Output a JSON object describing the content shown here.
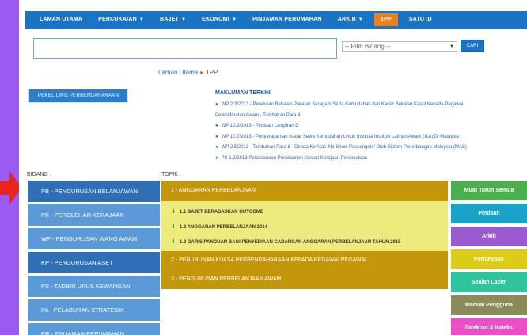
{
  "nav": {
    "items": [
      {
        "label": "LAMAN UTAMA",
        "caret": false
      },
      {
        "label": "PERCUKAIAN",
        "caret": true
      },
      {
        "label": "BAJET",
        "caret": true
      },
      {
        "label": "EKONOMI",
        "caret": true
      },
      {
        "label": "PINJAMAN PERUMAHAN",
        "caret": false
      },
      {
        "label": "ARKIB",
        "caret": true
      },
      {
        "label": "1PP",
        "caret": false
      },
      {
        "label": "SATU ID",
        "caret": false
      }
    ],
    "caret_glyph": "▼"
  },
  "search": {
    "value": "",
    "select_value": "-- Pilih Bidang --",
    "button_label": "CARI"
  },
  "breadcrumb": {
    "home": "Laman Utama",
    "separator": "▸",
    "current": "1PP"
  },
  "pekeliling_button": "PEKELILING PERBENDAHARAAN",
  "makluman": {
    "title": "MAKLUMAN TERKINI",
    "items": [
      "WP 2.3/2013 - Peraturan Bekalan Pakaian Seragam Serta Kemudahan dan Kadar Bekalan Kasut Kepada Pegawai",
      "Perkhidmatan Awam - Tambahan Para 4",
      "WP 10.2/2013 - Pindaan Lampiran D",
      "WP 10.7/2013 - Penyeragaman Kadar Sewa Kemudahan Untuk Institusi Institusi Latihan Awam (ILA) Di Malaysia",
      "WP 2.5/2013 - Tambahan Para 8 - Denda Ke Atas 'No Show Passengers' Oleh Sistem Penerbangan Malaysia (MAS)",
      "PS 1.2/2013 Pelaksanaan Perakaunan Akruan Kerajaan Persekutuan"
    ],
    "bullet": "●"
  },
  "bidang": {
    "label": "BIDANG :",
    "items": [
      "PB - PENGURUSAN BELANJAWAN",
      "PK - PEROLEHAN KERAJAAN",
      "WP - PENGURUSAN WANG AWAM",
      "KP - PENGURUSAN ASET",
      "PS - TADBIR URUS KEWANGAN",
      "PA - PELABURAN STRATEGIK",
      "PR - PINJAMAN PERUMAHAN"
    ]
  },
  "topik": {
    "label": "TOPIK :",
    "head1": "1 - ANGGARAN PERBELANJAAN",
    "subitems": [
      "1.1 BAJET BERASASKAN OUTCOME",
      "1.2 ANGGARAN PERBELANJAAN 2014",
      "1.3 GARIS PANDUAN BAGI PENYEDIAAN CADANGAN ANGGARAN PERBELANJAAN TAHUN 2015"
    ],
    "down_glyph": "⬇",
    "head2": "2 - PENURUNAN KUASA PERBENDAHARAAN KEPADA PEGAWAI PEGAWAL",
    "head3": "3 - PENGURUSAN PERBELANJAAN AWAM"
  },
  "side_buttons": [
    {
      "label": "Muat Turun Semua",
      "color": "#4cae4c"
    },
    {
      "label": "Pindaan",
      "color": "#1aa3c9"
    },
    {
      "label": "Arkib",
      "color": "#9a5bd0"
    },
    {
      "label": "Pertanyaan",
      "color": "#dccb18"
    },
    {
      "label": "Soalan Lazim",
      "color": "#2fc49c"
    },
    {
      "label": "Manual Pengguna",
      "color": "#8b8a5a"
    },
    {
      "label": "Direktori & Indeks",
      "color": "#e94fc7"
    }
  ],
  "colors": {
    "nav": "#1b73c4",
    "nav_active": "#f07e1a",
    "border": "#9b5bf2",
    "arrow": "#e8251f",
    "topik_head": "#c49609",
    "topik_sub": "#eeeb7e"
  }
}
